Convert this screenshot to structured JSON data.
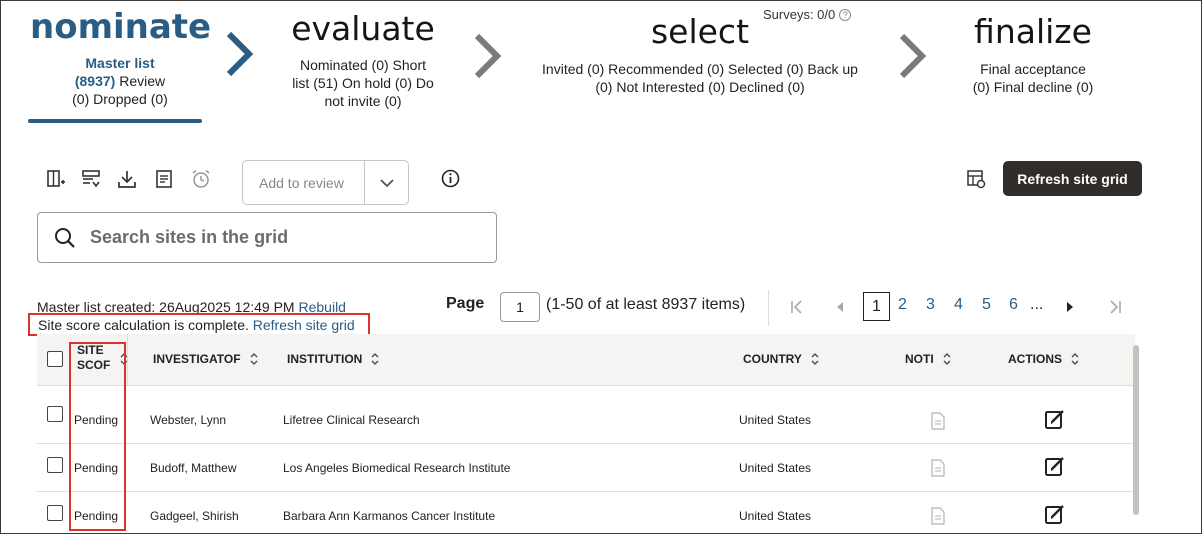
{
  "stepper": {
    "nominate": {
      "title": "nominate",
      "link_text": "Master list",
      "count": "(8937)",
      "desc_rest_1": " Review",
      "desc_rest_2": "(0)  Dropped (0)"
    },
    "evaluate": {
      "title": "evaluate",
      "line1": "Nominated (0)  Short",
      "line2": "list (51)  On hold (0)  Do",
      "line3": "not invite (0)"
    },
    "select": {
      "title": "select",
      "line1": "Invited (0)  Recommended (0)  Selected (0)  Back up",
      "line2": "(0)  Not Interested (0)  Declined (0)"
    },
    "finalize": {
      "title": "finalize",
      "line1": "Final acceptance",
      "line2": "(0)  Final decline (0)"
    },
    "surveys": "Surveys: 0/0",
    "help_glyph": "?"
  },
  "toolbar": {
    "add_to_review_label": "Add to review",
    "refresh_label": "Refresh site grid"
  },
  "search": {
    "placeholder": "Search sites in the grid"
  },
  "status": {
    "created_text": "Master list created: 26Aug2025 12:49 PM ",
    "rebuild_link": "Rebuild",
    "score_text": "Site score calculation is complete. ",
    "refresh_link": "Refresh site grid"
  },
  "pagination": {
    "page_label": "Page",
    "page_value": "1",
    "range_text": "(1-50 of at least 8937 items)",
    "current": "1",
    "pages": [
      "2",
      "3",
      "4",
      "5",
      "6"
    ],
    "ellipsis": "..."
  },
  "table": {
    "headers": {
      "site_score_1": "SITE",
      "site_score_2": "SCOF",
      "investigator": "INVESTIGATOF",
      "institution": "INSTITUTION",
      "country": "COUNTRY",
      "notes": "NOTI",
      "actions": "ACTIONS"
    },
    "rows": [
      {
        "score": "Pending",
        "investigator": "Webster, Lynn",
        "institution": "Lifetree Clinical Research",
        "country": "United States"
      },
      {
        "score": "Pending",
        "investigator": "Budoff, Matthew",
        "institution": "Los Angeles Biomedical Research Institute",
        "country": "United States"
      },
      {
        "score": "Pending",
        "investigator": "Gadgeel, Shirish",
        "institution": "Barbara Ann Karmanos Cancer Institute",
        "country": "United States"
      }
    ]
  },
  "colors": {
    "accent": "#2a5d84",
    "highlight_border": "#d9342b",
    "primary_button": "#312d2a"
  }
}
